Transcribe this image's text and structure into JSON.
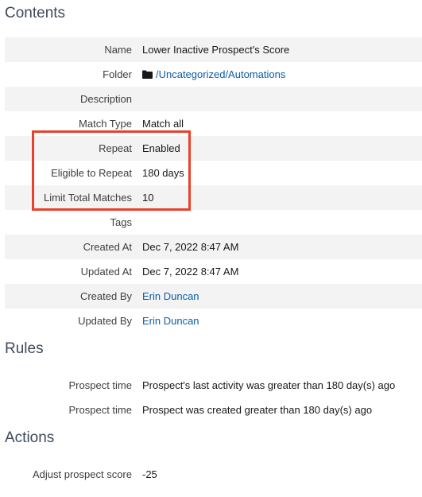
{
  "contents": {
    "title": "Contents",
    "rows": [
      {
        "label": "Name",
        "value": "Lower Inactive Prospect's Score"
      },
      {
        "label": "Folder",
        "value": "/Uncategorized/Automations",
        "icon": "folder-icon"
      },
      {
        "label": "Description",
        "value": ""
      },
      {
        "label": "Match Type",
        "value": "Match all"
      },
      {
        "label": "Repeat",
        "value": "Enabled"
      },
      {
        "label": "Eligible to Repeat",
        "value": "180 days"
      },
      {
        "label": "Limit Total Matches",
        "value": "10"
      },
      {
        "label": "Tags",
        "value": ""
      },
      {
        "label": "Created At",
        "value": "Dec 7, 2022 8:47 AM"
      },
      {
        "label": "Updated At",
        "value": "Dec 7, 2022 8:47 AM"
      },
      {
        "label": "Created By",
        "value": "Erin Duncan"
      },
      {
        "label": "Updated By",
        "value": "Erin Duncan"
      }
    ]
  },
  "rules": {
    "title": "Rules",
    "rows": [
      {
        "label": "Prospect time",
        "value": "Prospect's last activity was greater than 180 day(s) ago"
      },
      {
        "label": "Prospect time",
        "value": "Prospect was created greater than 180 day(s) ago"
      }
    ]
  },
  "actions": {
    "title": "Actions",
    "rows": [
      {
        "label": "Adjust prospect score",
        "value": "-25"
      }
    ]
  },
  "colors": {
    "highlight_border": "#e8412c",
    "link": "#0b5cab",
    "row_shade": "#f3f3f3"
  }
}
